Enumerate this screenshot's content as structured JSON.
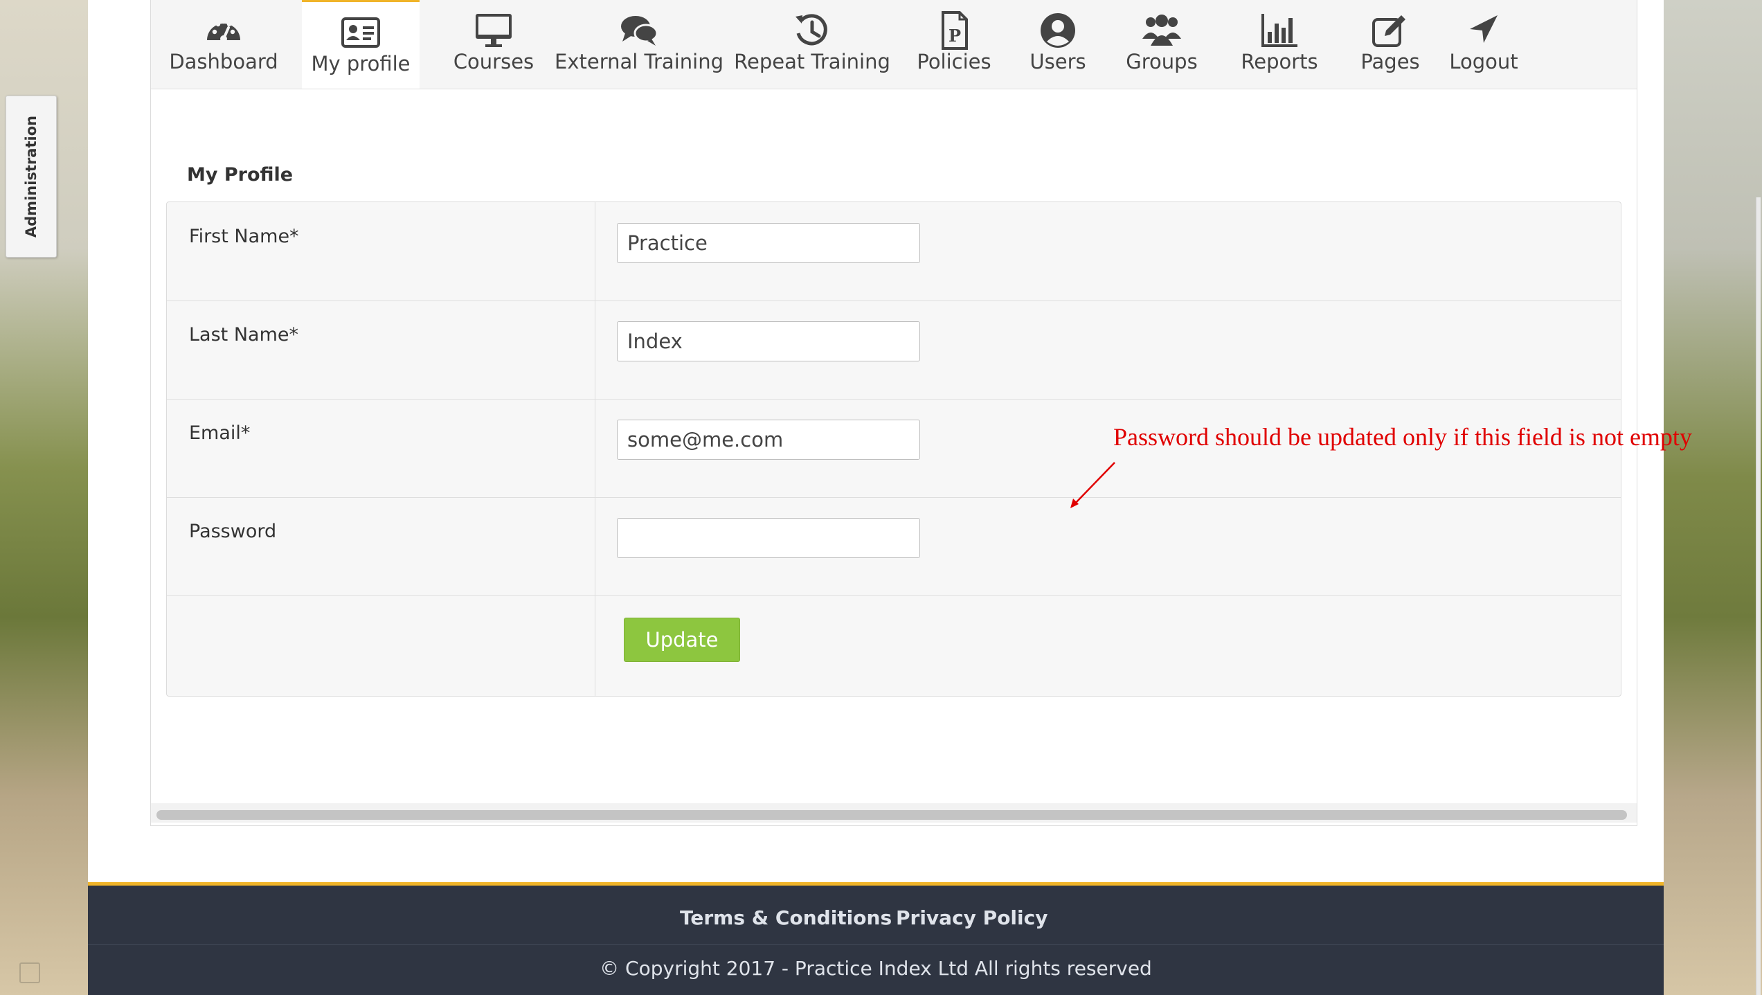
{
  "sidebar": {
    "admin_tab_label": "Administration"
  },
  "nav": {
    "items": [
      {
        "label": "Dashboard",
        "icon": "dashboard-icon"
      },
      {
        "label": "My profile",
        "icon": "id-card-icon",
        "active": true
      },
      {
        "label": "Courses",
        "icon": "monitor-icon"
      },
      {
        "label": "External Training",
        "icon": "chat-bubbles-icon"
      },
      {
        "label": "Repeat Training",
        "icon": "history-icon"
      },
      {
        "label": "Policies",
        "icon": "policy-document-icon"
      },
      {
        "label": "Users",
        "icon": "user-circle-icon"
      },
      {
        "label": "Groups",
        "icon": "users-group-icon"
      },
      {
        "label": "Reports",
        "icon": "bar-chart-icon"
      },
      {
        "label": "Pages",
        "icon": "edit-page-icon"
      },
      {
        "label": "Logout",
        "icon": "location-arrow-icon"
      }
    ],
    "accent_color": "#f0b429"
  },
  "profile": {
    "title": "My Profile",
    "fields": [
      {
        "label": "First Name*",
        "value": "Practice"
      },
      {
        "label": "Last Name*",
        "value": "Index"
      },
      {
        "label": "Email*",
        "value": "some@me.com"
      },
      {
        "label": "Password",
        "value": ""
      }
    ],
    "update_label": "Update",
    "update_color": "#8dc63f"
  },
  "annotation": {
    "text": "Password should be updated only if this field is not empty",
    "color": "#e00000"
  },
  "footer": {
    "links": [
      "Terms & Conditions",
      "Privacy Policy"
    ],
    "copyright": "© Copyright 2017 - Practice Index Ltd All rights reserved"
  }
}
